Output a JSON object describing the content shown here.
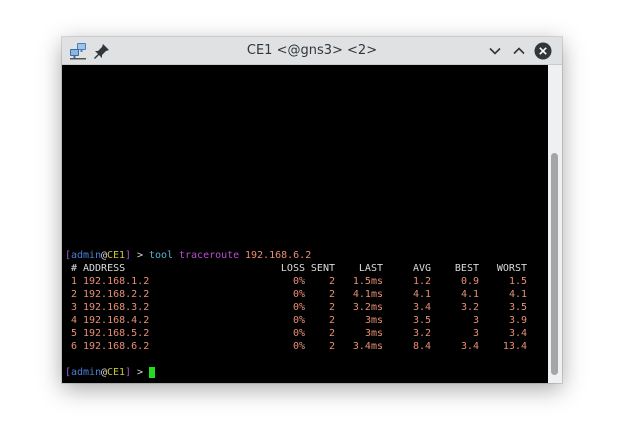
{
  "window": {
    "title": "CE1 <@gns3> <2>",
    "icons": {
      "app": "network-computers-icon",
      "pin": "pin-icon",
      "minimize": "chevron-down-icon",
      "maximize": "chevron-up-icon",
      "close": "close-icon"
    }
  },
  "terminal": {
    "prompt": {
      "open_bracket": "[",
      "user": "admin",
      "at": "@",
      "host": "CE1",
      "close_bracket": "]",
      "arrow": ">"
    },
    "command": {
      "tool": "tool",
      "subcommand": "traceroute",
      "target": "192.168.6.2"
    },
    "headers": {
      "num": "#",
      "address": "ADDRESS",
      "loss": "LOSS",
      "sent": "SENT",
      "last": "LAST",
      "avg": "AVG",
      "best": "BEST",
      "worst": "WORST"
    },
    "rows": [
      {
        "num": "1",
        "address": "192.168.1.2",
        "loss": "0%",
        "sent": "2",
        "last": "1.5ms",
        "avg": "1.2",
        "best": "0.9",
        "worst": "1.5"
      },
      {
        "num": "2",
        "address": "192.168.2.2",
        "loss": "0%",
        "sent": "2",
        "last": "4.1ms",
        "avg": "4.1",
        "best": "4.1",
        "worst": "4.1"
      },
      {
        "num": "3",
        "address": "192.168.3.2",
        "loss": "0%",
        "sent": "2",
        "last": "3.2ms",
        "avg": "3.4",
        "best": "3.2",
        "worst": "3.5"
      },
      {
        "num": "4",
        "address": "192.168.4.2",
        "loss": "0%",
        "sent": "2",
        "last": "3ms",
        "avg": "3.5",
        "best": "3",
        "worst": "3.9"
      },
      {
        "num": "5",
        "address": "192.168.5.2",
        "loss": "0%",
        "sent": "2",
        "last": "3ms",
        "avg": "3.2",
        "best": "3",
        "worst": "3.4"
      },
      {
        "num": "6",
        "address": "192.168.6.2",
        "loss": "0%",
        "sent": "2",
        "last": "3.4ms",
        "avg": "8.4",
        "best": "3.4",
        "worst": "13.4"
      }
    ]
  },
  "colors": {
    "terminal_bg": "#000000",
    "titlebar_bg": "#dfe1e3",
    "prompt_bracket": "#a855d9",
    "prompt_user": "#4a7fd8",
    "prompt_host": "#c8c83a",
    "command": "#55b4d4",
    "path": "#b94fd0",
    "values": "#e88f74",
    "cursor": "#22dd22"
  }
}
